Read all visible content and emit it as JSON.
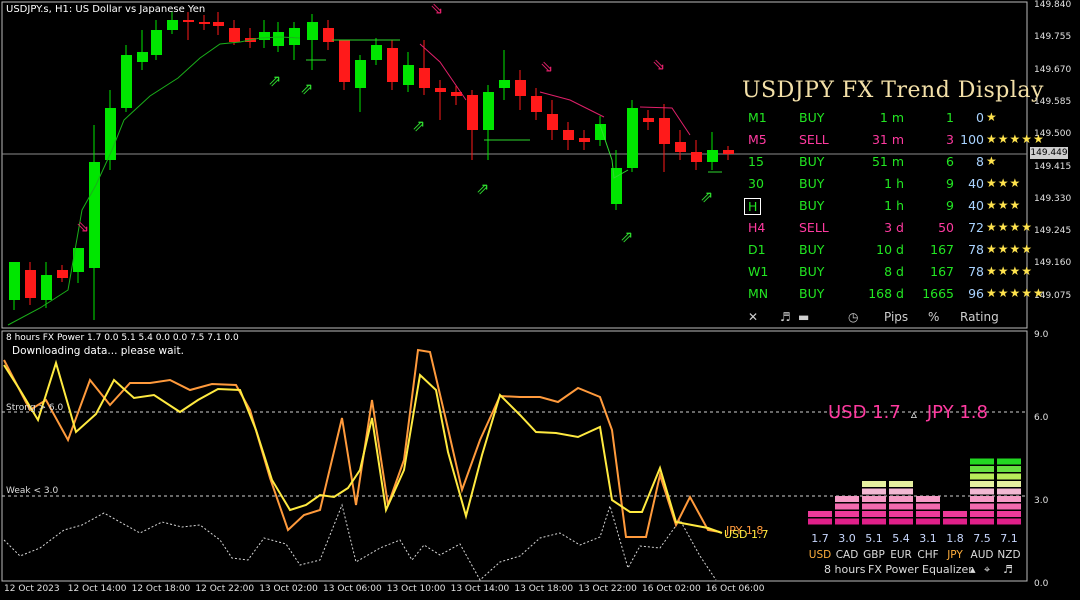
{
  "window": {
    "title": "USDJPY.s, H1:  US Dollar vs Japanese Yen",
    "current_price": "149.449"
  },
  "price_axis": [
    "149.840",
    "149.755",
    "149.670",
    "149.585",
    "149.500",
    "149.415",
    "149.330",
    "149.245",
    "149.160",
    "149.075"
  ],
  "time_axis": [
    "12 Oct 2023",
    "12 Oct 14:00",
    "12 Oct 18:00",
    "12 Oct 22:00",
    "13 Oct 02:00",
    "13 Oct 06:00",
    "13 Oct 10:00",
    "13 Oct 14:00",
    "13 Oct 18:00",
    "13 Oct 22:00",
    "16 Oct 02:00",
    "16 Oct 06:00"
  ],
  "trend_display": {
    "title": "USDJPY FX Trend Display",
    "rows": [
      {
        "tf": "M1",
        "dir": "BUY",
        "dur": "1 m",
        "pips": "1",
        "pct": "0",
        "stars": "★",
        "sell": false,
        "boxed": false
      },
      {
        "tf": "M5",
        "dir": "SELL",
        "dur": "31 m",
        "pips": "3",
        "pct": "100",
        "stars": "★★★★★",
        "sell": true,
        "boxed": false
      },
      {
        "tf": "15",
        "dir": "BUY",
        "dur": "51 m",
        "pips": "6",
        "pct": "8",
        "stars": "★",
        "sell": false,
        "boxed": false
      },
      {
        "tf": "30",
        "dir": "BUY",
        "dur": "1 h",
        "pips": "9",
        "pct": "40",
        "stars": "★★★",
        "sell": false,
        "boxed": false
      },
      {
        "tf": "H",
        "dir": "BUY",
        "dur": "1 h",
        "pips": "9",
        "pct": "40",
        "stars": "★★★",
        "sell": false,
        "boxed": true
      },
      {
        "tf": "H4",
        "dir": "SELL",
        "dur": "3 d",
        "pips": "50",
        "pct": "72",
        "stars": "★★★★",
        "sell": true,
        "boxed": false
      },
      {
        "tf": "D1",
        "dir": "BUY",
        "dur": "10 d",
        "pips": "167",
        "pct": "78",
        "stars": "★★★★",
        "sell": false,
        "boxed": false
      },
      {
        "tf": "W1",
        "dir": "BUY",
        "dur": "8 d",
        "pips": "167",
        "pct": "78",
        "stars": "★★★★",
        "sell": false,
        "boxed": false
      },
      {
        "tf": "MN",
        "dir": "BUY",
        "dur": "168 d",
        "pips": "1665",
        "pct": "96",
        "stars": "★★★★★",
        "sell": false,
        "boxed": false
      }
    ],
    "footer": {
      "close": "✕",
      "sound": "♬",
      "pips": "Pips",
      "pct": "%",
      "rating": "Rating"
    }
  },
  "indicator": {
    "header": "8 hours FX Power 1.7 0.0 5.1 5.4 0.0 0.0 7.5 7.1 0.0",
    "status": "Downloading data... please wait.",
    "strong_label": "Strong > 6.0",
    "weak_label": "Weak < 3.0",
    "axis": [
      "9.0",
      "6.0",
      "3.0",
      "0.0"
    ],
    "usd_tag": "USD 1.7",
    "jpy_tag": "JPY 1.8",
    "strength_left": "USD 1.7",
    "strength_right": "JPY 1.8",
    "strength_symbol": "▵"
  },
  "equalizer": {
    "values": [
      1.7,
      3.0,
      5.1,
      5.4,
      3.1,
      1.8,
      7.5,
      7.1
    ],
    "value_labels": [
      "1.7",
      "3.0",
      "5.1",
      "5.4",
      "3.1",
      "1.8",
      "7.5",
      "7.1"
    ],
    "currencies": [
      "USD",
      "CAD",
      "GBP",
      "EUR",
      "CHF",
      "JPY",
      "AUD",
      "NZD"
    ],
    "highlight": [
      "USD",
      "JPY"
    ],
    "footer": {
      "period": "8 hours",
      "name": "FX Power",
      "mode": "Equalizer",
      "up": "▴",
      "crosshair": "⌖",
      "sound": "♬"
    }
  },
  "colors": {
    "bull": "#00e600",
    "bear": "#ff1a1a",
    "sell": "#ff3aa0",
    "buy": "#22e622",
    "usd_line": "#ffea40",
    "jpy_line": "#ff9a3c",
    "star": "#ffe34d"
  }
}
